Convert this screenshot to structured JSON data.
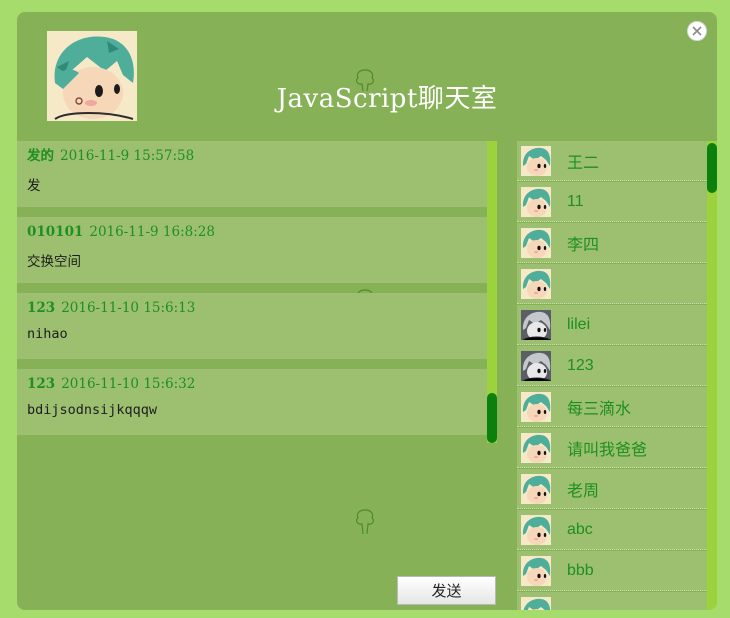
{
  "header": {
    "title": "JavaScript聊天室",
    "close_icon": "close-icon",
    "avatar_icon": "cartoon-boy-avatar"
  },
  "messages": [
    {
      "user": "发的",
      "time": "2016-11-9 15:57:58",
      "text": "发"
    },
    {
      "user": "010101",
      "time": "2016-11-9 16:8:28",
      "text": "交换空间"
    },
    {
      "user": "123",
      "time": "2016-11-10 15:6:13",
      "text": "nihao"
    },
    {
      "user": "123",
      "time": "2016-11-10 15:6:32",
      "text": "bdijsodnsijkqqqw"
    }
  ],
  "users": [
    {
      "name": "王二",
      "avatar": "green"
    },
    {
      "name": "11",
      "avatar": "green"
    },
    {
      "name": "李四",
      "avatar": "green"
    },
    {
      "name": "",
      "avatar": "green"
    },
    {
      "name": "lilei",
      "avatar": "gray"
    },
    {
      "name": "123",
      "avatar": "gray"
    },
    {
      "name": "每三滴水",
      "avatar": "green"
    },
    {
      "name": "请叫我爸爸",
      "avatar": "green"
    },
    {
      "name": "老周",
      "avatar": "green"
    },
    {
      "name": "abc",
      "avatar": "green"
    },
    {
      "name": "bbb",
      "avatar": "green"
    },
    {
      "name": "",
      "avatar": "green"
    }
  ],
  "composer": {
    "send_label": "发送"
  },
  "colors": {
    "page_bg": "#a6dc6c",
    "window_bg": "#86b157",
    "item_bg": "#9cc070",
    "accent": "#1f8f1f",
    "scroll_track": "#9cd23c",
    "scroll_thumb": "#0c800c"
  }
}
